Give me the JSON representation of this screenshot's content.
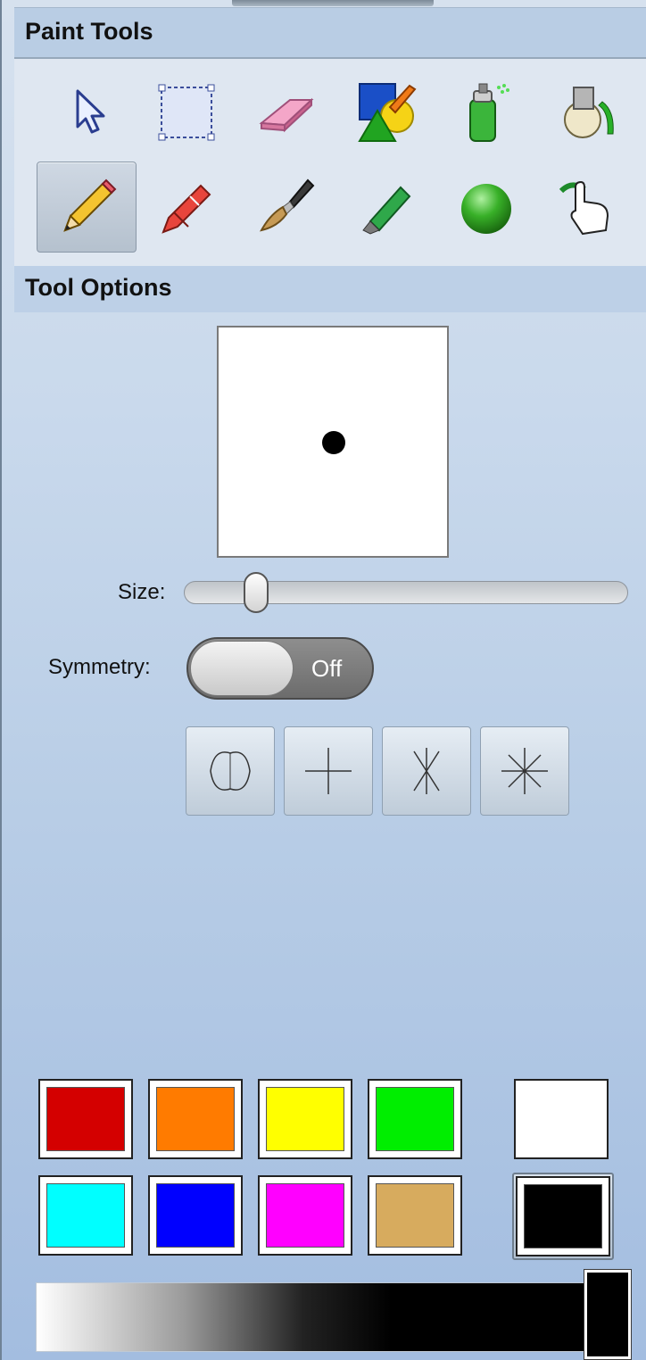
{
  "paint_tools": {
    "title": "Paint Tools",
    "tools": [
      {
        "name": "select-arrow-icon",
        "selected": false
      },
      {
        "name": "rectangle-select-icon",
        "selected": false
      },
      {
        "name": "eraser-icon",
        "selected": false
      },
      {
        "name": "shapes-icon",
        "selected": false
      },
      {
        "name": "spray-can-icon",
        "selected": false
      },
      {
        "name": "paint-bucket-icon",
        "selected": false
      },
      {
        "name": "pencil-icon",
        "selected": true
      },
      {
        "name": "crayon-icon",
        "selected": false
      },
      {
        "name": "paintbrush-icon",
        "selected": false
      },
      {
        "name": "marker-icon",
        "selected": false
      },
      {
        "name": "green-ball-icon",
        "selected": false
      },
      {
        "name": "finger-paint-icon",
        "selected": false
      }
    ]
  },
  "tool_options": {
    "title": "Tool Options",
    "size_label": "Size:",
    "size_value": 0.14,
    "symmetry_label": "Symmetry:",
    "symmetry_state": "Off",
    "symmetry_modes": [
      "mirror-symmetry-icon",
      "four-way-symmetry-icon",
      "six-way-symmetry-icon",
      "eight-way-symmetry-icon"
    ]
  },
  "palette": {
    "colors": [
      "#d40000",
      "#ff7b00",
      "#ffff00",
      "#00ee00",
      "#00ffff",
      "#0000ff",
      "#ff00ff",
      "#d7ab5e"
    ],
    "secondary": "#ffffff",
    "primary": "#000000"
  }
}
